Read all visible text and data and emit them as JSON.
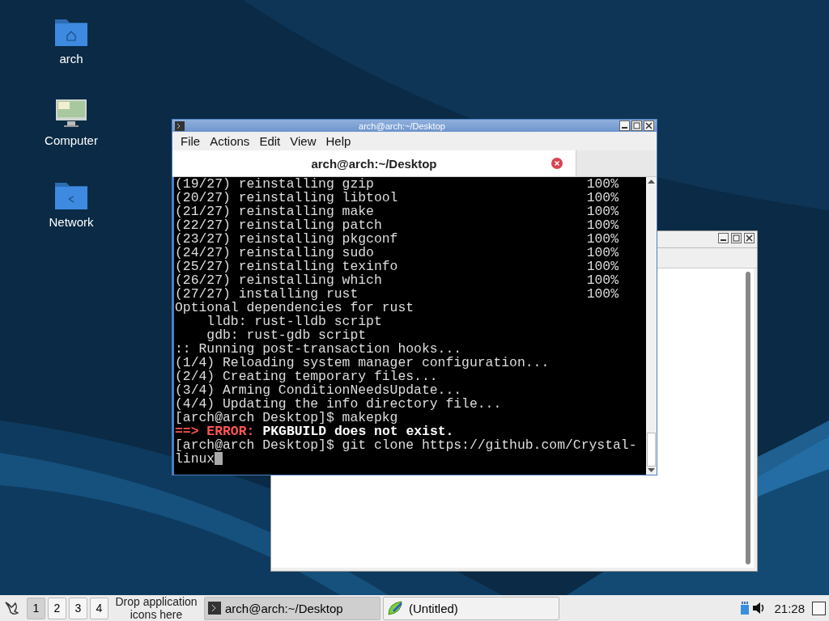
{
  "desktop_icons": [
    {
      "kind": "home",
      "label": "arch"
    },
    {
      "kind": "computer",
      "label": "Computer"
    },
    {
      "kind": "network",
      "label": "Network"
    }
  ],
  "back_window": {
    "kind": "editor"
  },
  "terminal": {
    "title": "arch@arch:~/Desktop",
    "menu": [
      "File",
      "Actions",
      "Edit",
      "View",
      "Help"
    ],
    "tab": {
      "label": "arch@arch:~/Desktop",
      "selected": true
    },
    "lines": [
      {
        "kind": "progress",
        "text": "(19/27) reinstalling gzip",
        "percent": "100%"
      },
      {
        "kind": "progress",
        "text": "(20/27) reinstalling libtool",
        "percent": "100%"
      },
      {
        "kind": "progress",
        "text": "(21/27) reinstalling make",
        "percent": "100%"
      },
      {
        "kind": "progress",
        "text": "(22/27) reinstalling patch",
        "percent": "100%"
      },
      {
        "kind": "progress",
        "text": "(23/27) reinstalling pkgconf",
        "percent": "100%"
      },
      {
        "kind": "progress",
        "text": "(24/27) reinstalling sudo",
        "percent": "100%"
      },
      {
        "kind": "progress",
        "text": "(25/27) reinstalling texinfo",
        "percent": "100%"
      },
      {
        "kind": "progress",
        "text": "(26/27) reinstalling which",
        "percent": "100%"
      },
      {
        "kind": "progress",
        "text": "(27/27) installing rust",
        "percent": "100%"
      },
      {
        "kind": "plain",
        "text": "Optional dependencies for rust"
      },
      {
        "kind": "plain",
        "text": "    lldb: rust-lldb script"
      },
      {
        "kind": "plain",
        "text": "    gdb: rust-gdb script"
      },
      {
        "kind": "plain",
        "text": ":: Running post-transaction hooks..."
      },
      {
        "kind": "plain",
        "text": "(1/4) Reloading system manager configuration..."
      },
      {
        "kind": "plain",
        "text": "(2/4) Creating temporary files..."
      },
      {
        "kind": "plain",
        "text": "(3/4) Arming ConditionNeedsUpdate..."
      },
      {
        "kind": "plain",
        "text": "(4/4) Updating the info directory file..."
      },
      {
        "kind": "plain",
        "text": "[arch@arch Desktop]$ makepkg"
      },
      {
        "kind": "error",
        "prefix": "==> ERROR:",
        "text": "PKGBUILD does not exist."
      },
      {
        "kind": "plain",
        "text": "[arch@arch Desktop]$ git clone https://github.com/Crystal-"
      },
      {
        "kind": "input",
        "text": "linux",
        "cursor": true
      }
    ]
  },
  "taskbar": {
    "workspaces": [
      {
        "label": "1",
        "selected": true
      },
      {
        "label": "2",
        "selected": false
      },
      {
        "label": "3",
        "selected": false
      },
      {
        "label": "4",
        "selected": false
      }
    ],
    "launcher_hint": "Drop application icons here",
    "tasks": [
      {
        "kind": "terminal",
        "label": "arch@arch:~/Desktop",
        "selected": true
      },
      {
        "kind": "editor",
        "label": "(Untitled)",
        "selected": false
      }
    ],
    "clock": "21:28"
  }
}
